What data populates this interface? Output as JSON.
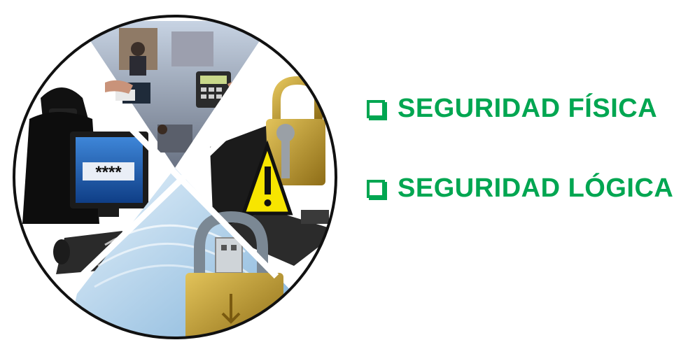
{
  "bullets": [
    {
      "label": "SEGURIDAD FÍSICA"
    },
    {
      "label": "SEGURIDAD LÓGICA"
    }
  ],
  "graphic": {
    "quadrants": [
      {
        "name": "physical-access-collage",
        "icons": [
          "person-icon",
          "keypad-icon",
          "card-reader-icon"
        ]
      },
      {
        "name": "password-thief",
        "text": "****",
        "icons": [
          "hacker-icon",
          "monitor-icon",
          "keyboard-icon",
          "mouse-icon"
        ]
      },
      {
        "name": "warning-laptop",
        "icons": [
          "padlock-icon",
          "key-icon",
          "warning-sign-icon",
          "laptop-icon"
        ]
      },
      {
        "name": "usb-padlock",
        "icons": [
          "usb-icon",
          "padlock-icon"
        ]
      }
    ]
  },
  "colors": {
    "accent": "#00a651",
    "circle_border": "#111111",
    "padlock_gold": "#c8a132",
    "warning_yellow": "#f7e500"
  }
}
